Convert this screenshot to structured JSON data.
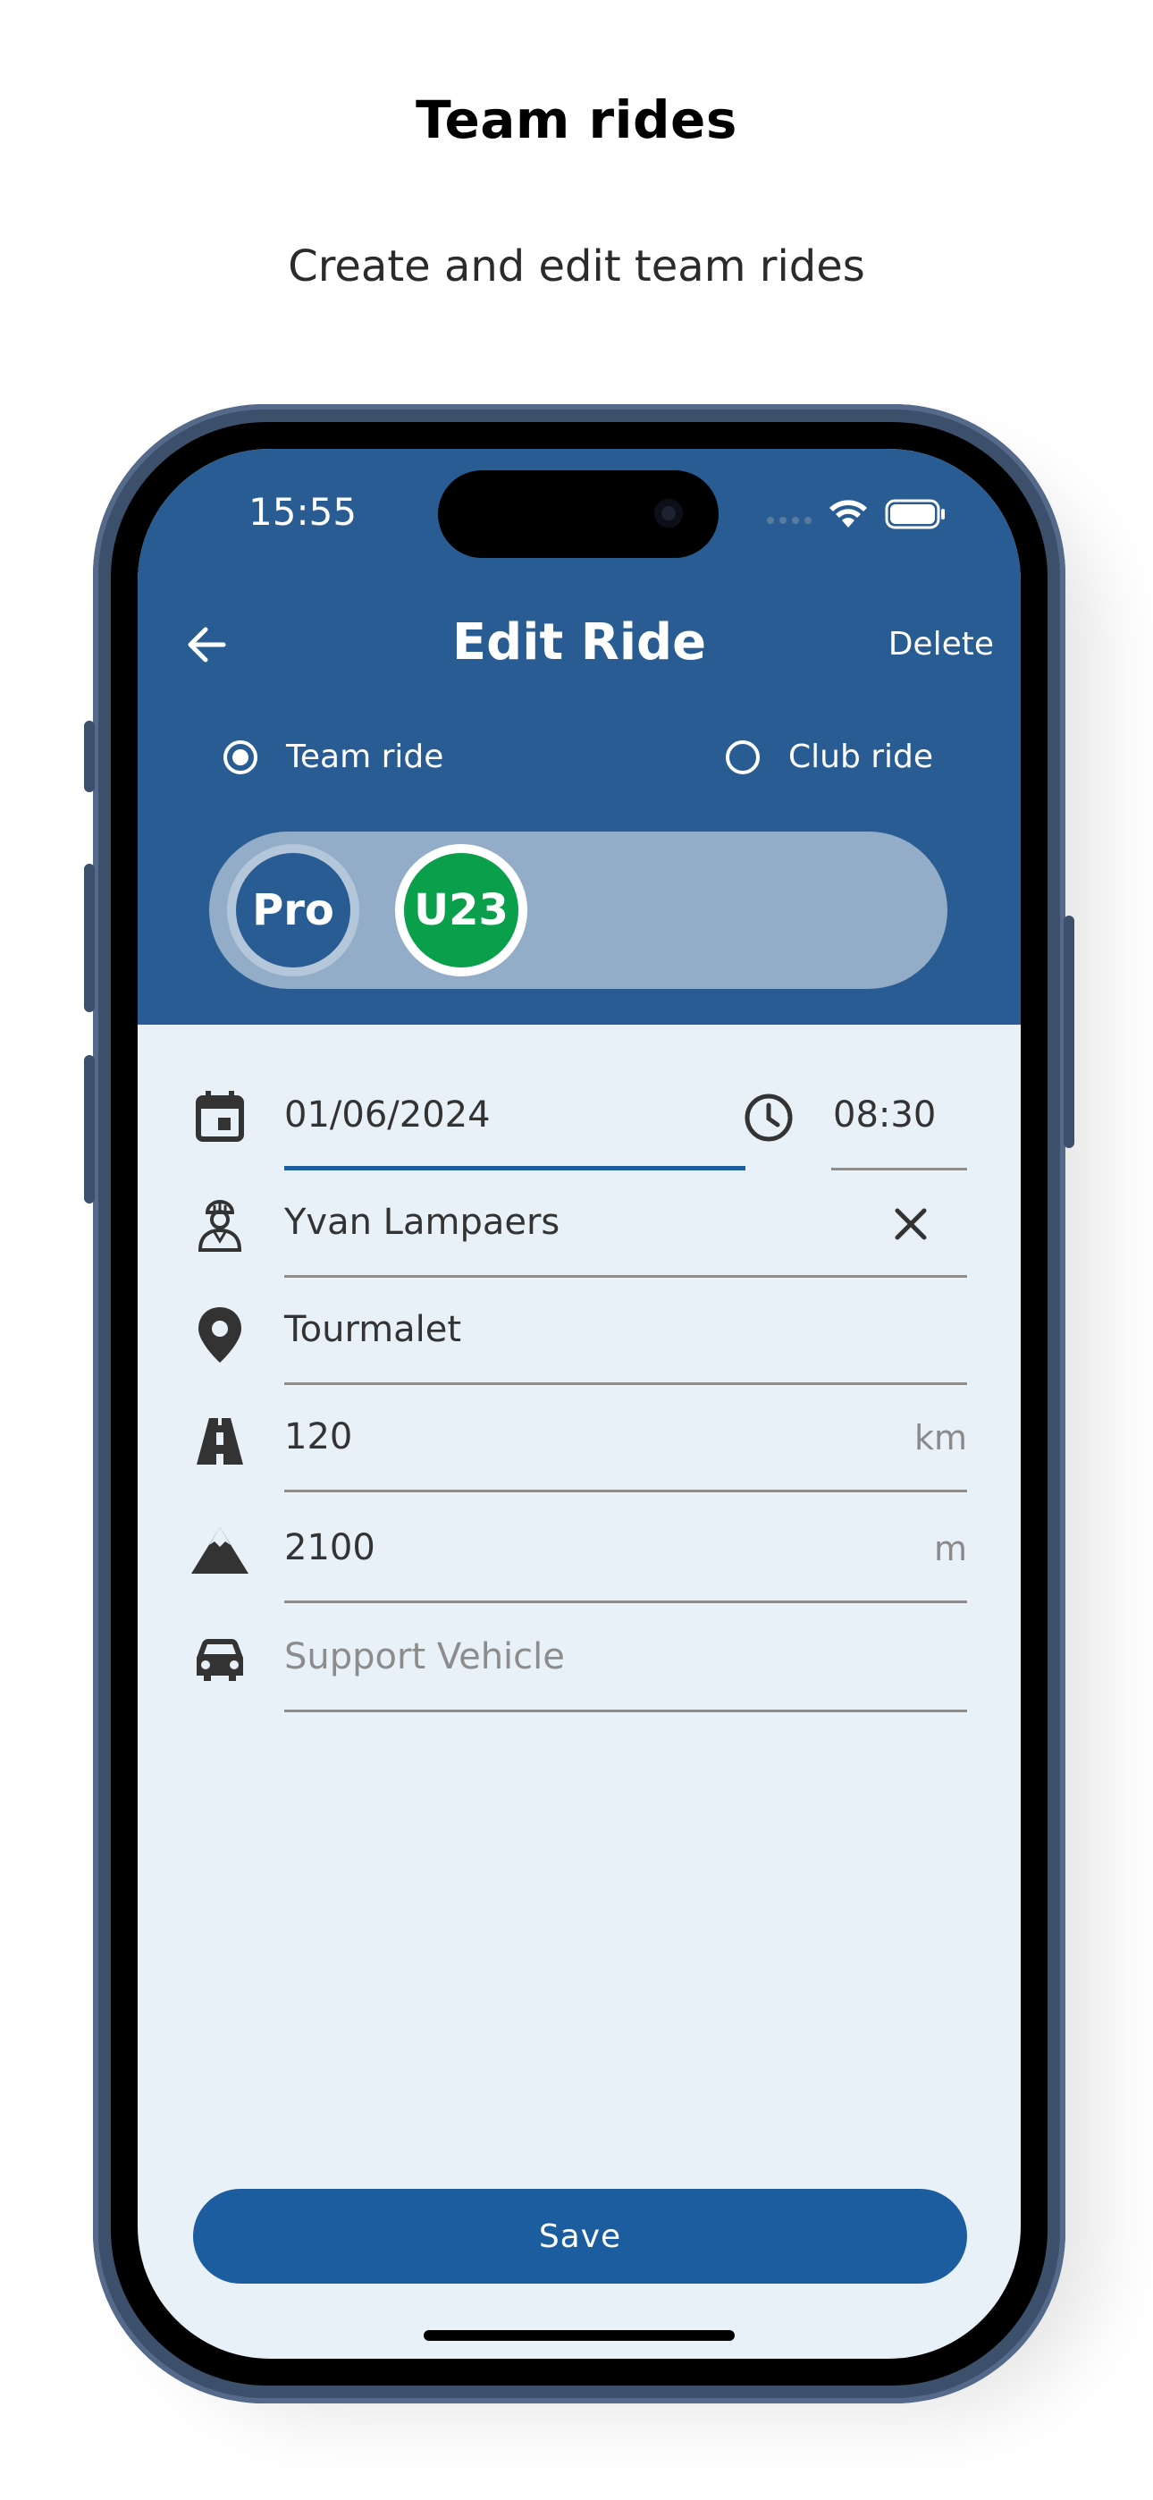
{
  "promo": {
    "title": "Team rides",
    "subtitle": "Create and edit team rides"
  },
  "status_bar": {
    "time": "15:55",
    "icons": [
      "cellular-signal-icon",
      "wifi-icon",
      "battery-icon"
    ]
  },
  "app_bar": {
    "title": "Edit Ride",
    "back_icon": "arrow-left-icon",
    "delete_label": "Delete"
  },
  "ride_type": {
    "options": [
      {
        "label": "Team ride",
        "selected": true
      },
      {
        "label": "Club ride",
        "selected": false
      }
    ]
  },
  "teams": [
    {
      "label": "Pro",
      "color": "#285c92",
      "selected": false
    },
    {
      "label": "U23",
      "color": "#0a9f4a",
      "selected": true
    }
  ],
  "form": {
    "date": {
      "value": "01/06/2024",
      "icon": "calendar-icon"
    },
    "time": {
      "value": "08:30",
      "icon": "clock-icon"
    },
    "rider": {
      "value": "Yvan Lampaers",
      "icon": "cyclist-icon",
      "clear_icon": "close-icon"
    },
    "location": {
      "value": "Tourmalet",
      "icon": "location-pin-icon"
    },
    "distance": {
      "value": "120",
      "unit": "km",
      "icon": "road-icon"
    },
    "elevation": {
      "value": "2100",
      "unit": "m",
      "icon": "mountain-icon"
    },
    "vehicle": {
      "placeholder": "Support Vehicle",
      "icon": "car-icon"
    }
  },
  "save_label": "Save",
  "colors": {
    "app_bar": "#285c92",
    "body": "#e8f0f8",
    "save_button": "#1c5da0",
    "active_underline": "#1c5da0"
  }
}
